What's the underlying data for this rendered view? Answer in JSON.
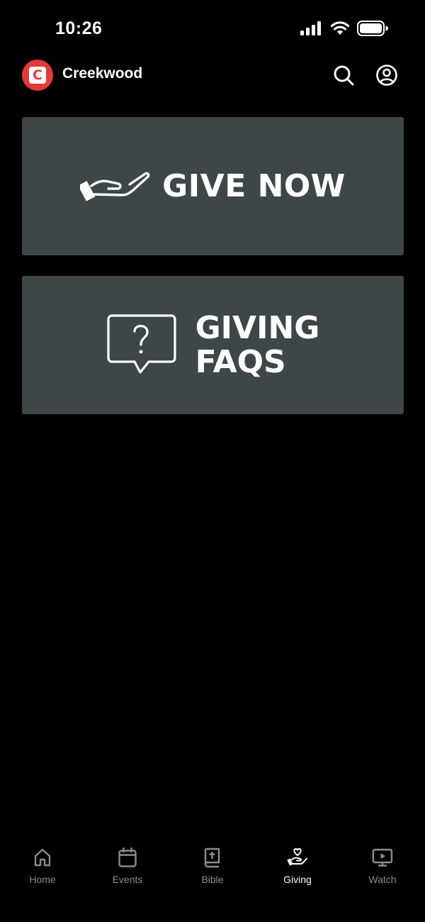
{
  "status_bar": {
    "time": "10:26"
  },
  "header": {
    "logo_letter": "C",
    "title": "Creekwood"
  },
  "cards": {
    "give_now": {
      "label": "GIVE NOW"
    },
    "giving_faqs": {
      "line1": "GIVING",
      "line2": "FAQS"
    }
  },
  "tab_bar": {
    "tabs": [
      {
        "label": "Home",
        "icon": "home-icon",
        "active": false
      },
      {
        "label": "Events",
        "icon": "calendar-icon",
        "active": false
      },
      {
        "label": "Bible",
        "icon": "bible-icon",
        "active": false
      },
      {
        "label": "Giving",
        "icon": "giving-hand-icon",
        "active": true
      },
      {
        "label": "Watch",
        "icon": "watch-play-icon",
        "active": false
      }
    ]
  },
  "colors": {
    "background": "#000000",
    "card": "#3f4648",
    "brand_red": "#e23a3a",
    "tab_inactive": "#8c8c8c",
    "tab_active": "#ffffff"
  }
}
